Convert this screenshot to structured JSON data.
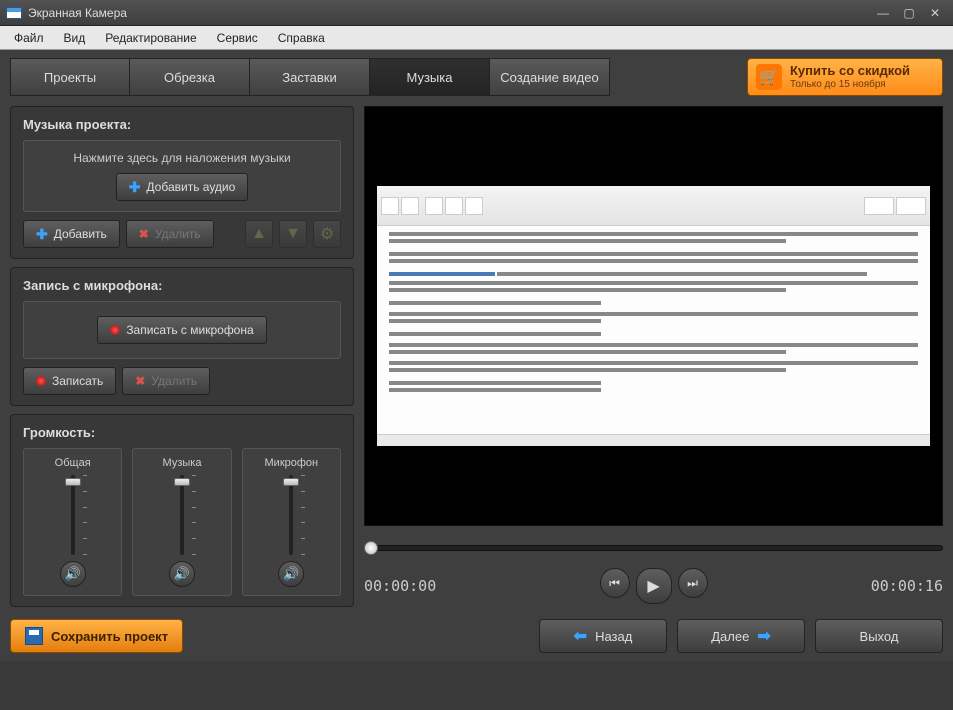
{
  "window": {
    "title": "Экранная Камера"
  },
  "menu": [
    "Файл",
    "Вид",
    "Редактирование",
    "Сервис",
    "Справка"
  ],
  "tabs": [
    {
      "label": "Проекты"
    },
    {
      "label": "Обрезка"
    },
    {
      "label": "Заставки"
    },
    {
      "label": "Музыка",
      "active": true
    },
    {
      "label": "Создание видео"
    }
  ],
  "buy": {
    "line1": "Купить со скидкой",
    "line2": "Только до 15 ноября"
  },
  "music": {
    "title": "Музыка проекта:",
    "drop_hint": "Нажмите здесь для наложения музыки",
    "add_audio": "Добавить аудио",
    "add": "Добавить",
    "delete": "Удалить"
  },
  "mic": {
    "title": "Запись с микрофона:",
    "record_from_mic": "Записать с микрофона",
    "record": "Записать",
    "delete": "Удалить"
  },
  "volume": {
    "title": "Громкость:",
    "cols": [
      "Общая",
      "Музыка",
      "Микрофон"
    ],
    "positions": [
      3,
      3,
      3
    ]
  },
  "player": {
    "current": "00:00:00",
    "total": "00:00:16"
  },
  "footer": {
    "save": "Сохранить проект",
    "back": "Назад",
    "next": "Далее",
    "exit": "Выход"
  }
}
